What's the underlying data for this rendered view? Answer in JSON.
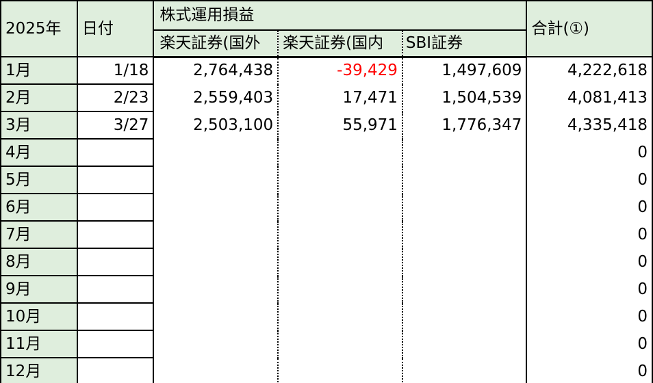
{
  "headers": {
    "year": "2025年",
    "date": "日付",
    "group": "株式運用損益",
    "rakuten_foreign": "楽天証券(国外",
    "rakuten_domestic": "楽天証券(国内",
    "sbi": "SBI証券",
    "total": "合計(①)"
  },
  "rows": [
    {
      "month": "1月",
      "date": "1/18",
      "rakuten_foreign": "2,764,438",
      "rakuten_domestic": "-39,429",
      "sbi": "1,497,609",
      "total": "4,222,618"
    },
    {
      "month": "2月",
      "date": "2/23",
      "rakuten_foreign": "2,559,403",
      "rakuten_domestic": "17,471",
      "sbi": "1,504,539",
      "total": "4,081,413"
    },
    {
      "month": "3月",
      "date": "3/27",
      "rakuten_foreign": "2,503,100",
      "rakuten_domestic": "55,971",
      "sbi": "1,776,347",
      "total": "4,335,418"
    },
    {
      "month": "4月",
      "date": "",
      "rakuten_foreign": "",
      "rakuten_domestic": "",
      "sbi": "",
      "total": "0"
    },
    {
      "month": "5月",
      "date": "",
      "rakuten_foreign": "",
      "rakuten_domestic": "",
      "sbi": "",
      "total": "0"
    },
    {
      "month": "6月",
      "date": "",
      "rakuten_foreign": "",
      "rakuten_domestic": "",
      "sbi": "",
      "total": "0"
    },
    {
      "month": "7月",
      "date": "",
      "rakuten_foreign": "",
      "rakuten_domestic": "",
      "sbi": "",
      "total": "0"
    },
    {
      "month": "8月",
      "date": "",
      "rakuten_foreign": "",
      "rakuten_domestic": "",
      "sbi": "",
      "total": "0"
    },
    {
      "month": "9月",
      "date": "",
      "rakuten_foreign": "",
      "rakuten_domestic": "",
      "sbi": "",
      "total": "0"
    },
    {
      "month": "10月",
      "date": "",
      "rakuten_foreign": "",
      "rakuten_domestic": "",
      "sbi": "",
      "total": "0"
    },
    {
      "month": "11月",
      "date": "",
      "rakuten_foreign": "",
      "rakuten_domestic": "",
      "sbi": "",
      "total": "0"
    },
    {
      "month": "12月",
      "date": "",
      "rakuten_foreign": "",
      "rakuten_domestic": "",
      "sbi": "",
      "total": "0"
    }
  ],
  "colors": {
    "header_fill": "#dfeedd",
    "negative": "#ff0000"
  }
}
